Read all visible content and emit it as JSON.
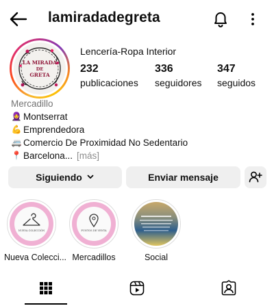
{
  "header": {
    "username": "lamiradadegreta"
  },
  "profile": {
    "avatar_text": [
      "LA MIRADA",
      "DE",
      "GRETA"
    ],
    "category": "Lencería-Ropa Interior",
    "stats": [
      {
        "value": "232",
        "label": "publicaciones"
      },
      {
        "value": "336",
        "label": "seguidores"
      },
      {
        "value": "347",
        "label": "seguidos"
      }
    ]
  },
  "bio": {
    "tag": "Mercadillo",
    "lines": [
      {
        "emoji": "🧕",
        "text": "Montserrat"
      },
      {
        "emoji": "💪",
        "text": "Emprendedora"
      },
      {
        "emoji": "🚐",
        "text": "Comercio De Proximidad No Sedentario"
      },
      {
        "emoji": "📍",
        "text": "Barcelona..."
      }
    ],
    "more": "[más]"
  },
  "actions": {
    "following": "Siguiendo",
    "message": "Enviar mensaje"
  },
  "highlights": [
    {
      "label": "Nueva Colecci...",
      "inner_text": "NUEVA COLECCIÓN"
    },
    {
      "label": "Mercadillos",
      "inner_text": "PUNTOS DE VENTA"
    },
    {
      "label": "Social"
    }
  ],
  "colors": {
    "highlight_pink": "#f0b0d3",
    "button_bg": "#efefef",
    "muted": "#737373"
  }
}
